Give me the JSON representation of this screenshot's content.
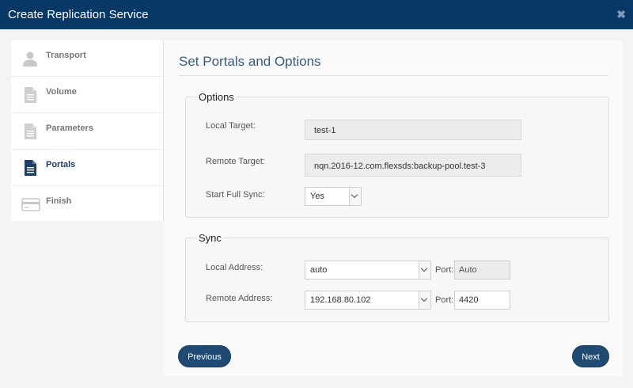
{
  "window": {
    "title": "Create Replication Service",
    "close_glyph": "✖"
  },
  "sidebar": {
    "items": [
      {
        "label": "Transport",
        "icon": "user-icon",
        "active": false
      },
      {
        "label": "Volume",
        "icon": "document-icon",
        "active": false
      },
      {
        "label": "Parameters",
        "icon": "document-icon",
        "active": false
      },
      {
        "label": "Portals",
        "icon": "document-icon",
        "active": true
      },
      {
        "label": "Finish",
        "icon": "card-icon",
        "active": false
      }
    ]
  },
  "main": {
    "title": "Set Portals and Options",
    "options": {
      "legend": "Options",
      "local_target_label": "Local Target:",
      "local_target_value": "test-1",
      "remote_target_label": "Remote Target:",
      "remote_target_value": "nqn.2016-12.com.flexsds:backup-pool.test-3",
      "full_sync_label": "Start Full Sync:",
      "full_sync_value": "Yes"
    },
    "sync": {
      "legend": "Sync",
      "local_address_label": "Local Address:",
      "local_address_value": "auto",
      "local_port_label": "Port:",
      "local_port_value": "Auto",
      "remote_address_label": "Remote Address:",
      "remote_address_value": "192.168.80.102",
      "remote_port_label": "Port:",
      "remote_port_value": "4420"
    }
  },
  "footer": {
    "previous_label": "Previous",
    "next_label": "Next"
  },
  "colors": {
    "titlebar": "#073866",
    "button": "#1e4a73",
    "active_icon": "#1a3a5f"
  }
}
